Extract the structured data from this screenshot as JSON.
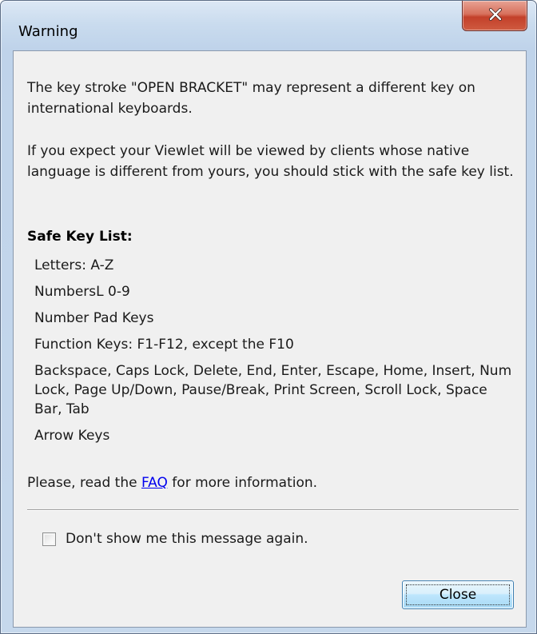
{
  "window": {
    "title": "Warning",
    "close_glyph": "x"
  },
  "message": {
    "paragraph1": "The key stroke \"OPEN BRACKET\" may represent a different key on international keyboards.",
    "paragraph2": "If you expect your Viewlet will be viewed by clients whose native language is different from yours, you should stick with the safe key list."
  },
  "safe_keys": {
    "heading": "Safe Key List:",
    "items": [
      "Letters: A-Z",
      "NumbersL 0-9",
      "Number Pad Keys",
      "Function Keys: F1-F12, except the F10",
      "Backspace, Caps Lock, Delete, End, Enter, Escape, Home, Insert, Num Lock, Page Up/Down, Pause/Break, Print Screen, Scroll Lock, Space Bar, Tab",
      "Arrow Keys"
    ]
  },
  "faq": {
    "prefix": "Please, read the ",
    "link_text": "FAQ",
    "suffix": " for more information."
  },
  "options": {
    "dont_show_label": "Don't show me this message again.",
    "dont_show_checked": false
  },
  "buttons": {
    "close_label": "Close"
  },
  "colors": {
    "link": "#0000ee",
    "close_x_red": "#c3402a",
    "button_blue": "#bee6fd"
  },
  "icons": {
    "title_close": "close-icon"
  }
}
